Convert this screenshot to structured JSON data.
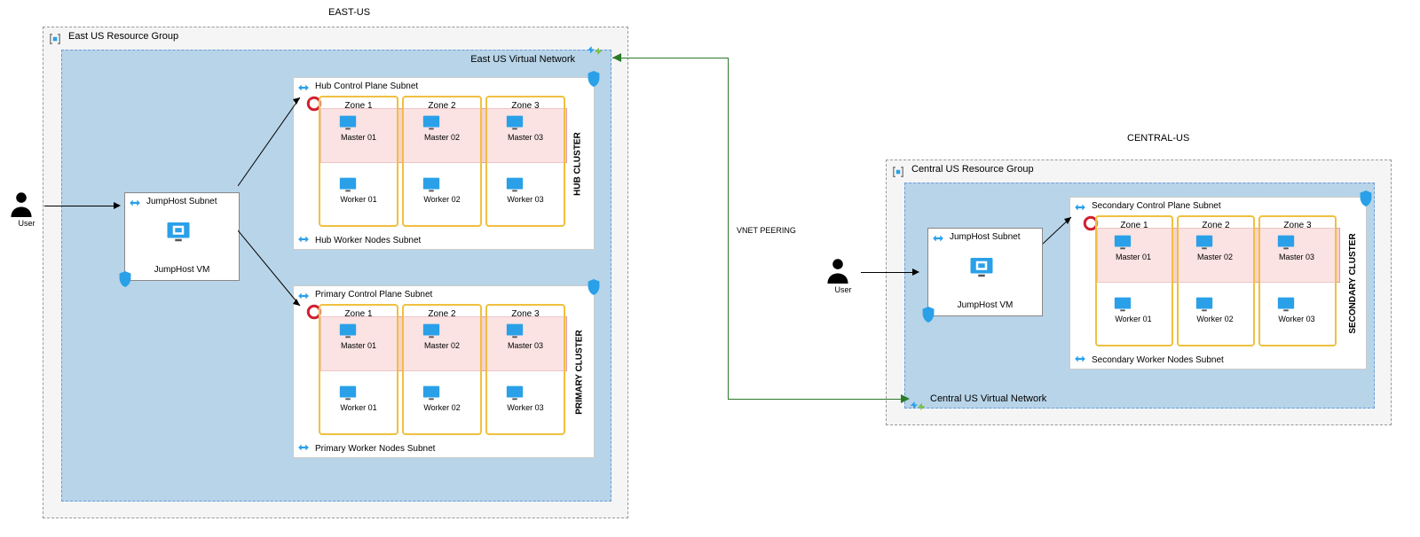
{
  "region_east_label": "EAST-US",
  "region_central_label": "CENTRAL-US",
  "vnet_peering_label": "VNET PEERING",
  "east": {
    "rg_title": "East US Resource Group",
    "vnet_title": "East US Virtual Network",
    "jumphost_subnet_title": "JumpHost Subnet",
    "jumphost_vm_label": "JumpHost VM",
    "user_label": "User",
    "hub": {
      "control_subnet_title": "Hub Control Plane Subnet",
      "worker_subnet_title": "Hub Worker Nodes Subnet",
      "cluster_label": "HUB CLUSTER",
      "zones": [
        "Zone 1",
        "Zone 2",
        "Zone 3"
      ],
      "masters": [
        "Master 01",
        "Master 02",
        "Master 03"
      ],
      "workers": [
        "Worker 01",
        "Worker 02",
        "Worker 03"
      ]
    },
    "primary": {
      "control_subnet_title": "Primary Control Plane Subnet",
      "worker_subnet_title": "Primary Worker Nodes Subnet",
      "cluster_label": "PRIMARY CLUSTER",
      "zones": [
        "Zone 1",
        "Zone 2",
        "Zone 3"
      ],
      "masters": [
        "Master 01",
        "Master 02",
        "Master 03"
      ],
      "workers": [
        "Worker 01",
        "Worker 02",
        "Worker 03"
      ]
    }
  },
  "central": {
    "rg_title": "Central US Resource Group",
    "vnet_title": "Central US Virtual Network",
    "jumphost_subnet_title": "JumpHost Subnet",
    "jumphost_vm_label": "JumpHost VM",
    "user_label": "User",
    "secondary": {
      "control_subnet_title": "Secondary Control Plane Subnet",
      "worker_subnet_title": "Secondary Worker Nodes Subnet",
      "cluster_label": "SECONDARY CLUSTER",
      "zones": [
        "Zone 1",
        "Zone 2",
        "Zone 3"
      ],
      "masters": [
        "Master 01",
        "Master 02",
        "Master 03"
      ],
      "workers": [
        "Worker 01",
        "Worker 02",
        "Worker 03"
      ]
    }
  }
}
